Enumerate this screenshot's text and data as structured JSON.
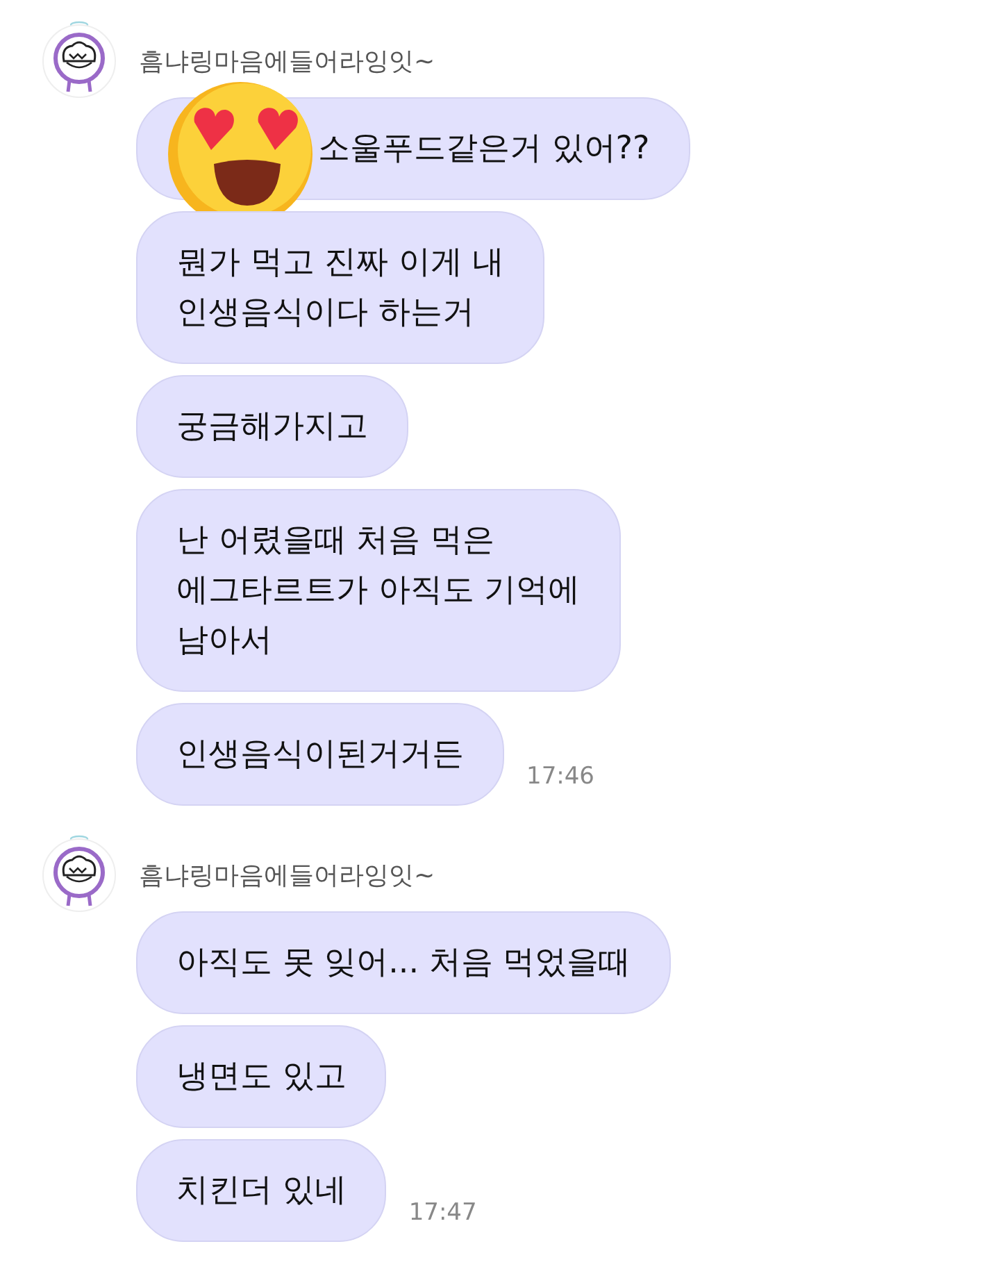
{
  "groups": [
    {
      "sender": "흠냐링마음에들어라잉잇~",
      "messages": [
        {
          "text": "소울푸드같은거 있어??",
          "sticker": true
        },
        {
          "text": "뭔가 먹고 진짜 이게 내\n인생음식이다 하는거"
        },
        {
          "text": "궁금해가지고"
        },
        {
          "text": "난 어렸을때 처음 먹은\n에그타르트가 아직도 기억에\n남아서"
        },
        {
          "text": "인생음식이된거거든",
          "time": "17:46"
        }
      ]
    },
    {
      "sender": "흠냐링마음에들어라잉잇~",
      "messages": [
        {
          "text": "아직도 못 잊어... 처음 먹었을때"
        },
        {
          "text": "냉면도 있고"
        },
        {
          "text": "치킨더 있네",
          "time": "17:47"
        }
      ]
    }
  ]
}
